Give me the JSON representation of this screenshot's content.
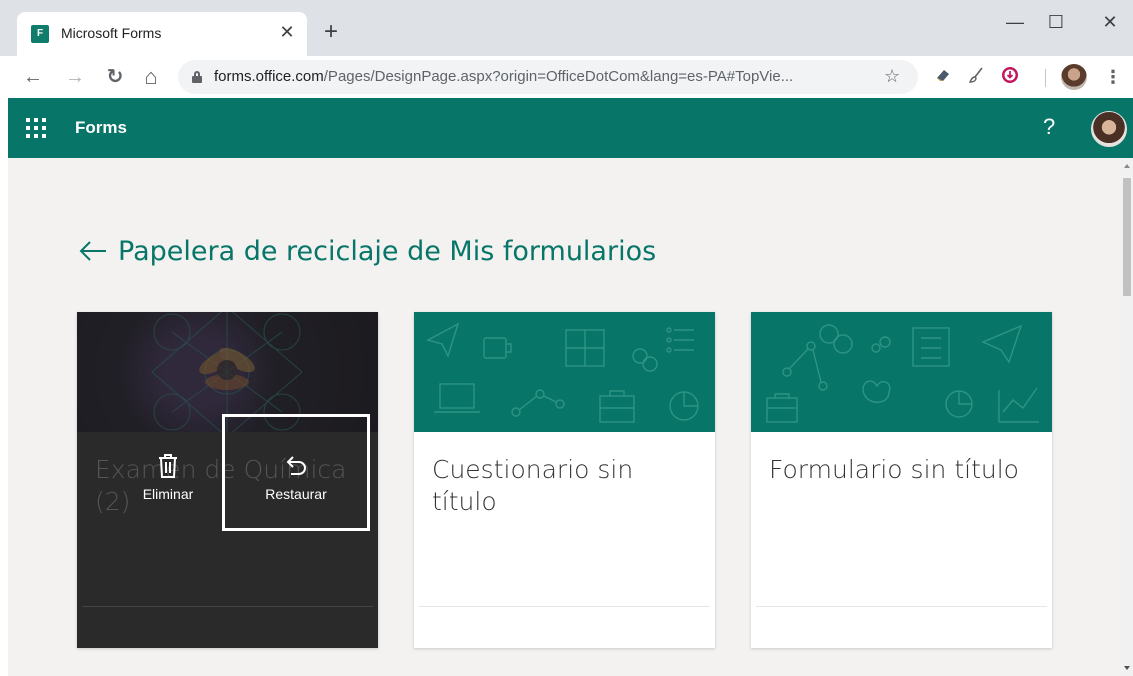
{
  "browser": {
    "tab": {
      "title": "Microsoft Forms",
      "favicon_text": "F",
      "close_glyph": "✕"
    },
    "new_tab_glyph": "+",
    "window_controls": {
      "minimize": "—",
      "maximize": "☐",
      "close": "✕"
    },
    "toolbar": {
      "back_glyph": "←",
      "forward_glyph": "→",
      "reload_glyph": "↻",
      "home_glyph": "⌂",
      "url_host": "forms.office.com",
      "url_path": "/Pages/DesignPage.aspx?origin=OfficeDotCom&lang=es-PA#TopVie...",
      "bookmark_glyph": "☆",
      "menu_glyph": "⋮"
    }
  },
  "app": {
    "name": "Forms",
    "help_glyph": "?",
    "accent_color": "#077568"
  },
  "page": {
    "title": "Papelera de reciclaje de Mis formularios",
    "cards": [
      {
        "title": "Examen de Química (2)",
        "actions": {
          "delete_label": "Eliminar",
          "restore_label": "Restaurar"
        }
      },
      {
        "title": "Cuestionario sin título"
      },
      {
        "title": "Formulario sin título"
      }
    ]
  }
}
